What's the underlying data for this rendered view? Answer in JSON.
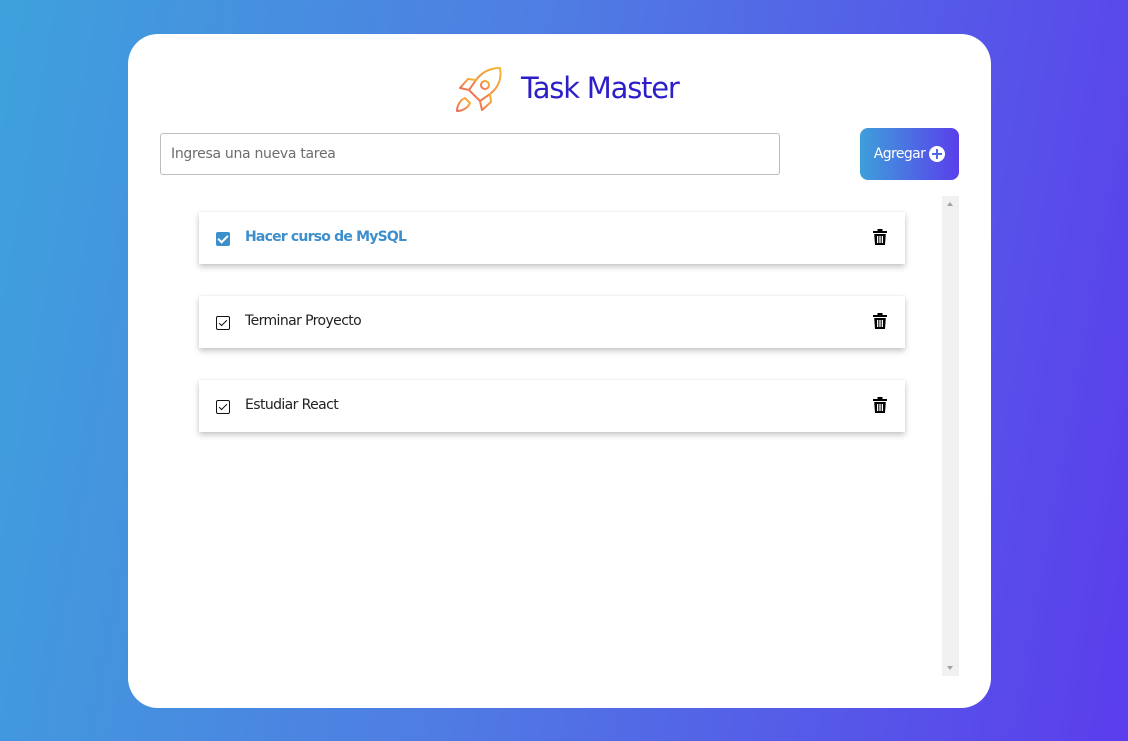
{
  "app": {
    "title": "Task Master",
    "logo_icon": "rocket-icon"
  },
  "input": {
    "placeholder": "Ingresa una nueva tarea",
    "value": ""
  },
  "add_button": {
    "label": "Agregar",
    "icon": "plus-circle-icon"
  },
  "tasks": [
    {
      "text": "Hacer curso de MySQL",
      "completed": true
    },
    {
      "text": "Terminar Proyecto",
      "completed": false
    },
    {
      "text": "Estudiar React",
      "completed": false
    }
  ],
  "icons": {
    "delete": "trash-icon"
  },
  "colors": {
    "accent": "#3d8fcc",
    "title": "#2d1ec9",
    "gradient_start": "#3ea1dc",
    "gradient_end": "#5b3dec",
    "logo_orange": "#f0a13a",
    "logo_red": "#ef6b5c"
  }
}
